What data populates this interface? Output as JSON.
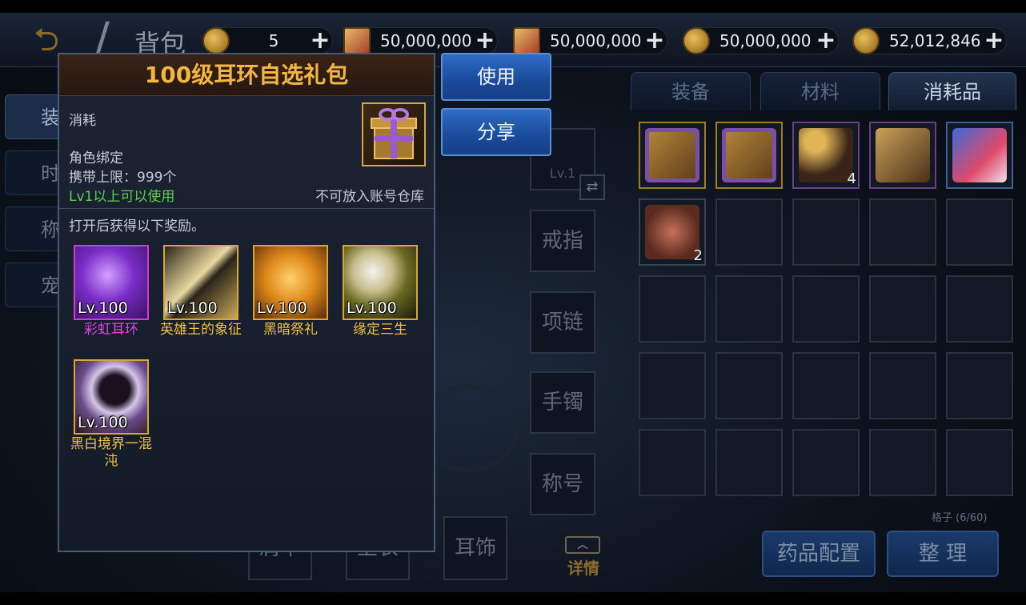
{
  "header": {
    "title": "背包",
    "resources": [
      {
        "icon": "coin-icon",
        "value": "5"
      },
      {
        "icon": "scroll-icon",
        "value": "50,000,000"
      },
      {
        "icon": "scroll-icon",
        "value": "50,000,000"
      },
      {
        "icon": "gold-coin-icon",
        "value": "50,000,000"
      },
      {
        "icon": "gold-coin-lock-icon",
        "value": "52,012,846"
      }
    ],
    "plus": "+"
  },
  "left_tabs": [
    "装",
    "时",
    "称",
    "宠"
  ],
  "inventory": {
    "tabs": [
      "装备",
      "材料",
      "消耗品"
    ],
    "active_tab": 2,
    "items": [
      {
        "icon": "gift-box-icon",
        "count": ""
      },
      {
        "icon": "gift-box-icon",
        "count": ""
      },
      {
        "icon": "hammer-icon",
        "count": "4"
      },
      {
        "icon": "treasure-chest-icon",
        "count": ""
      },
      {
        "icon": "magic-hand-icon",
        "count": ""
      },
      {
        "icon": "boar-head-icon",
        "count": "2"
      }
    ],
    "slots_label": "格子 (6/60)",
    "potion_btn": "药品配置",
    "sort_btn": "整 理"
  },
  "equip": {
    "weapon_level": "Lv.1",
    "swap": "⇄",
    "slots": [
      "戒指",
      "项链",
      "手镯",
      "称号"
    ],
    "lower_slots": [
      "肩甲",
      "上衣",
      "耳饰"
    ],
    "detail_arrow": "︿",
    "detail_label": "详情"
  },
  "popup": {
    "title": "100级耳环自选礼包",
    "type": "消耗",
    "bind": "角色绑定",
    "limit": "携带上限：999个",
    "level_req": "Lv1以上可以使用",
    "no_warehouse": "不可放入账号仓库",
    "reward_title": "打开后获得以下奖励。",
    "rewards": [
      {
        "level": "Lv.100",
        "name": "彩虹耳环",
        "quality": "purple",
        "icon": "rainbow-earring-icon"
      },
      {
        "level": "Lv.100",
        "name": "英雄王的象征",
        "quality": "gold",
        "icon": "hero-king-ring-icon"
      },
      {
        "level": "Lv.100",
        "name": "黑暗祭礼",
        "quality": "gold",
        "icon": "dark-ritual-ring-icon"
      },
      {
        "level": "Lv.100",
        "name": "缘定三生",
        "quality": "gold",
        "icon": "destiny-ring-icon"
      },
      {
        "level": "Lv.100",
        "name": "黑白境界一混沌",
        "quality": "gold",
        "icon": "chaos-orb-icon"
      }
    ]
  },
  "actions": {
    "use": "使用",
    "share": "分享"
  }
}
